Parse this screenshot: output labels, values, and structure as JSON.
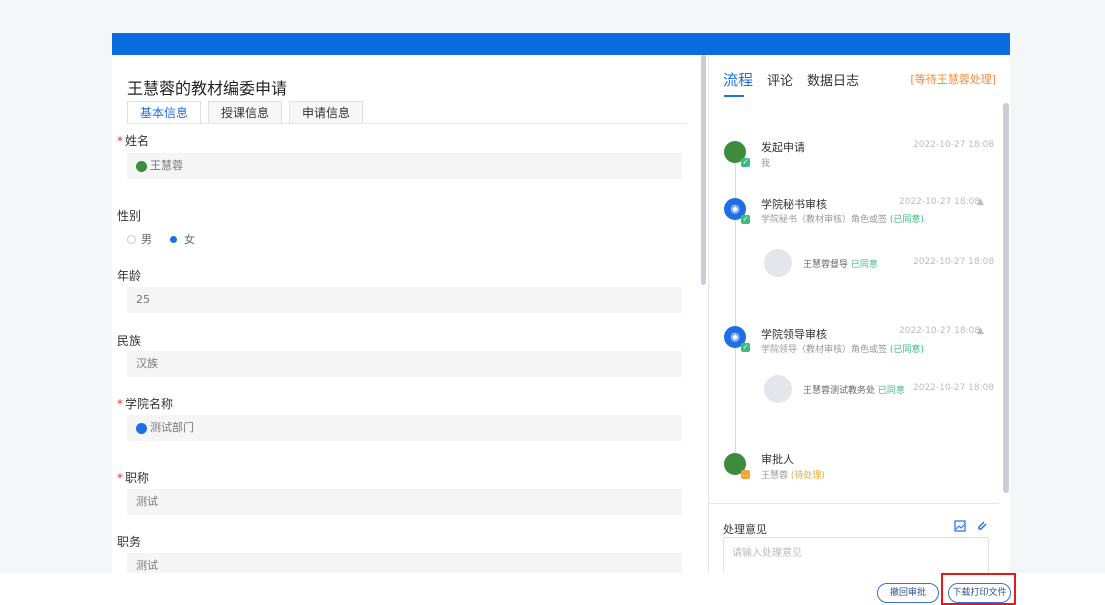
{
  "form": {
    "title": "王慧蓉的教材编委申请",
    "tabs": [
      "基本信息",
      "授课信息",
      "申请信息"
    ],
    "fields": {
      "name": {
        "label": "姓名",
        "required": true,
        "value": "王慧蓉"
      },
      "gender": {
        "label": "性别",
        "options": [
          "男",
          "女"
        ],
        "selected": "女"
      },
      "age": {
        "label": "年龄",
        "value": "25"
      },
      "ethnicity": {
        "label": "民族",
        "value": "汉族"
      },
      "college": {
        "label": "学院名称",
        "required": true,
        "value": "测试部门"
      },
      "title_rank": {
        "label": "职称",
        "required": true,
        "value": "测试"
      },
      "position": {
        "label": "职务",
        "value": "测试"
      }
    }
  },
  "panel": {
    "tabs": [
      "流程",
      "评论",
      "数据日志"
    ],
    "active_tab": "流程",
    "status": "[等待王慧蓉处理]",
    "timeline": [
      {
        "title": "发起申请",
        "sub": "我",
        "time": "2022-10-27 18:08"
      },
      {
        "title": "学院秘书审核",
        "sub": "学院秘书（教材审核）角色或签",
        "status": "(已同意)",
        "time": "2022-10-27 18:08",
        "arrow": "▲",
        "approver": {
          "name": "王慧蓉督导",
          "status": "已同意",
          "time": "2022-10-27 18:08"
        }
      },
      {
        "title": "学院领导审核",
        "sub": "学院领导（教材审核）角色或签",
        "status": "(已同意)",
        "time": "2022-10-27 18:08",
        "arrow": "▲",
        "approver": {
          "name": "王慧蓉测试教务处",
          "status": "已同意",
          "time": "2022-10-27 18:08"
        }
      },
      {
        "title": "审批人",
        "sub": "王慧蓉",
        "status": "(待处理)"
      }
    ],
    "opinion": {
      "label": "处理意见",
      "placeholder": "请输入处理意见"
    }
  },
  "footer": {
    "revoke_label": "撤回审批",
    "download_label": "下载打印文件"
  },
  "colors": {
    "brand": "#0a6cdf",
    "accent": "#1e6ee8",
    "required": "#e5342b",
    "approved": "#3dbd7d",
    "pending": "#f0a63b",
    "highlight": "#e3191f"
  },
  "icons": [
    "user-icon",
    "building-icon",
    "image-icon",
    "attachment-icon",
    "check-icon",
    "caret-up-icon"
  ]
}
